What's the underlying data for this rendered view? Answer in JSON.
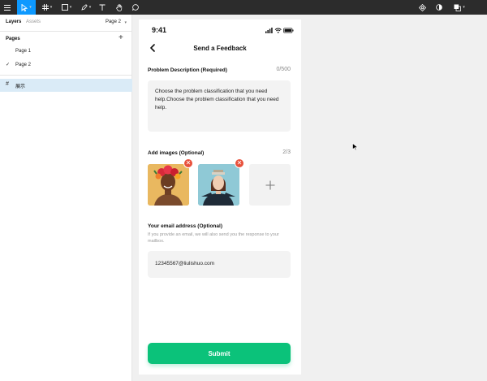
{
  "sidebar": {
    "tabs": {
      "layers": "Layers",
      "assets": "Assets",
      "page": "Page 2"
    },
    "pages_heading": "Pages",
    "pages": [
      "Page 1",
      "Page 2"
    ],
    "layer": "展示"
  },
  "phone": {
    "status_time": "9:41",
    "title": "Send a Feedback",
    "description": {
      "label": "Problem Description (Required)",
      "count": "0/500",
      "text": "Choose the problem classification that you need help.Choose the problem classification that you need help."
    },
    "images": {
      "label": "Add images (Optional)",
      "count": "2/3"
    },
    "email": {
      "label": "Your email address (Optional)",
      "hint": "If you provide an email, we will also send you the response to your mailbox.",
      "value": "12345567@liulishuo.com"
    },
    "submit_label": "Submit"
  },
  "colors": {
    "toolbar": "#2c2c2c",
    "active_tool": "#0d99ff",
    "selected_layer": "#daebf7",
    "submit": "#0bc27a",
    "remove": "#e8503b"
  }
}
